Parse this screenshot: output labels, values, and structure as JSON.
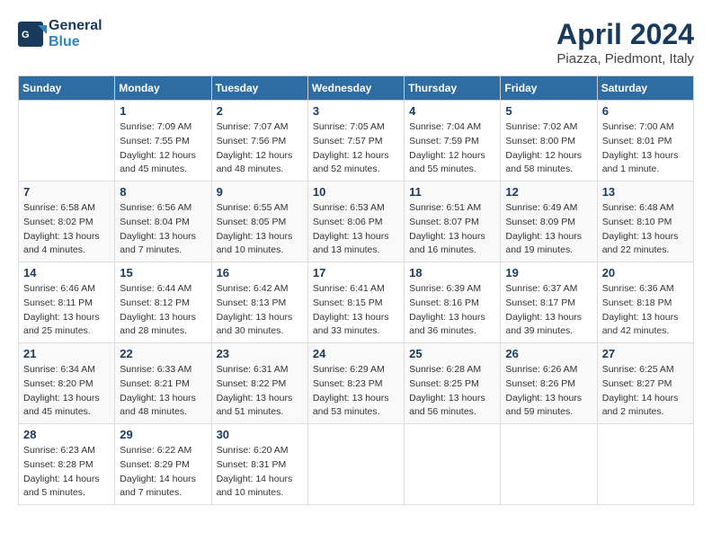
{
  "header": {
    "logo_general": "General",
    "logo_blue": "Blue",
    "month": "April 2024",
    "location": "Piazza, Piedmont, Italy"
  },
  "weekdays": [
    "Sunday",
    "Monday",
    "Tuesday",
    "Wednesday",
    "Thursday",
    "Friday",
    "Saturday"
  ],
  "weeks": [
    [
      {
        "day": "",
        "info": ""
      },
      {
        "day": "1",
        "info": "Sunrise: 7:09 AM\nSunset: 7:55 PM\nDaylight: 12 hours\nand 45 minutes."
      },
      {
        "day": "2",
        "info": "Sunrise: 7:07 AM\nSunset: 7:56 PM\nDaylight: 12 hours\nand 48 minutes."
      },
      {
        "day": "3",
        "info": "Sunrise: 7:05 AM\nSunset: 7:57 PM\nDaylight: 12 hours\nand 52 minutes."
      },
      {
        "day": "4",
        "info": "Sunrise: 7:04 AM\nSunset: 7:59 PM\nDaylight: 12 hours\nand 55 minutes."
      },
      {
        "day": "5",
        "info": "Sunrise: 7:02 AM\nSunset: 8:00 PM\nDaylight: 12 hours\nand 58 minutes."
      },
      {
        "day": "6",
        "info": "Sunrise: 7:00 AM\nSunset: 8:01 PM\nDaylight: 13 hours\nand 1 minute."
      }
    ],
    [
      {
        "day": "7",
        "info": "Sunrise: 6:58 AM\nSunset: 8:02 PM\nDaylight: 13 hours\nand 4 minutes."
      },
      {
        "day": "8",
        "info": "Sunrise: 6:56 AM\nSunset: 8:04 PM\nDaylight: 13 hours\nand 7 minutes."
      },
      {
        "day": "9",
        "info": "Sunrise: 6:55 AM\nSunset: 8:05 PM\nDaylight: 13 hours\nand 10 minutes."
      },
      {
        "day": "10",
        "info": "Sunrise: 6:53 AM\nSunset: 8:06 PM\nDaylight: 13 hours\nand 13 minutes."
      },
      {
        "day": "11",
        "info": "Sunrise: 6:51 AM\nSunset: 8:07 PM\nDaylight: 13 hours\nand 16 minutes."
      },
      {
        "day": "12",
        "info": "Sunrise: 6:49 AM\nSunset: 8:09 PM\nDaylight: 13 hours\nand 19 minutes."
      },
      {
        "day": "13",
        "info": "Sunrise: 6:48 AM\nSunset: 8:10 PM\nDaylight: 13 hours\nand 22 minutes."
      }
    ],
    [
      {
        "day": "14",
        "info": "Sunrise: 6:46 AM\nSunset: 8:11 PM\nDaylight: 13 hours\nand 25 minutes."
      },
      {
        "day": "15",
        "info": "Sunrise: 6:44 AM\nSunset: 8:12 PM\nDaylight: 13 hours\nand 28 minutes."
      },
      {
        "day": "16",
        "info": "Sunrise: 6:42 AM\nSunset: 8:13 PM\nDaylight: 13 hours\nand 30 minutes."
      },
      {
        "day": "17",
        "info": "Sunrise: 6:41 AM\nSunset: 8:15 PM\nDaylight: 13 hours\nand 33 minutes."
      },
      {
        "day": "18",
        "info": "Sunrise: 6:39 AM\nSunset: 8:16 PM\nDaylight: 13 hours\nand 36 minutes."
      },
      {
        "day": "19",
        "info": "Sunrise: 6:37 AM\nSunset: 8:17 PM\nDaylight: 13 hours\nand 39 minutes."
      },
      {
        "day": "20",
        "info": "Sunrise: 6:36 AM\nSunset: 8:18 PM\nDaylight: 13 hours\nand 42 minutes."
      }
    ],
    [
      {
        "day": "21",
        "info": "Sunrise: 6:34 AM\nSunset: 8:20 PM\nDaylight: 13 hours\nand 45 minutes."
      },
      {
        "day": "22",
        "info": "Sunrise: 6:33 AM\nSunset: 8:21 PM\nDaylight: 13 hours\nand 48 minutes."
      },
      {
        "day": "23",
        "info": "Sunrise: 6:31 AM\nSunset: 8:22 PM\nDaylight: 13 hours\nand 51 minutes."
      },
      {
        "day": "24",
        "info": "Sunrise: 6:29 AM\nSunset: 8:23 PM\nDaylight: 13 hours\nand 53 minutes."
      },
      {
        "day": "25",
        "info": "Sunrise: 6:28 AM\nSunset: 8:25 PM\nDaylight: 13 hours\nand 56 minutes."
      },
      {
        "day": "26",
        "info": "Sunrise: 6:26 AM\nSunset: 8:26 PM\nDaylight: 13 hours\nand 59 minutes."
      },
      {
        "day": "27",
        "info": "Sunrise: 6:25 AM\nSunset: 8:27 PM\nDaylight: 14 hours\nand 2 minutes."
      }
    ],
    [
      {
        "day": "28",
        "info": "Sunrise: 6:23 AM\nSunset: 8:28 PM\nDaylight: 14 hours\nand 5 minutes."
      },
      {
        "day": "29",
        "info": "Sunrise: 6:22 AM\nSunset: 8:29 PM\nDaylight: 14 hours\nand 7 minutes."
      },
      {
        "day": "30",
        "info": "Sunrise: 6:20 AM\nSunset: 8:31 PM\nDaylight: 14 hours\nand 10 minutes."
      },
      {
        "day": "",
        "info": ""
      },
      {
        "day": "",
        "info": ""
      },
      {
        "day": "",
        "info": ""
      },
      {
        "day": "",
        "info": ""
      }
    ]
  ]
}
